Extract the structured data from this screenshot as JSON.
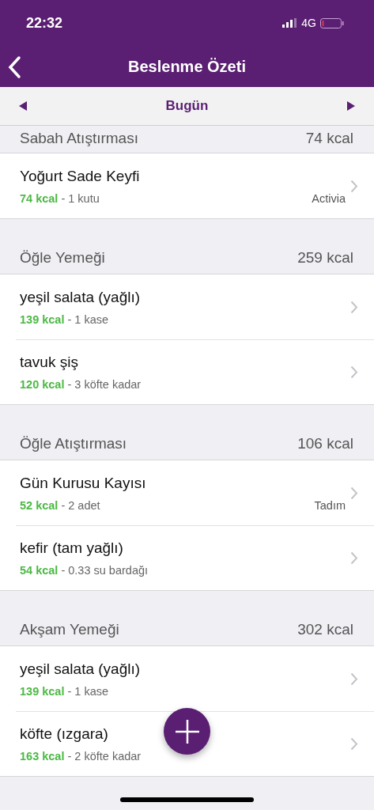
{
  "status_bar": {
    "time": "22:32",
    "network": "4G"
  },
  "nav": {
    "title": "Beslenme Özeti"
  },
  "date_bar": {
    "label": "Bugün"
  },
  "sections": [
    {
      "title": "Sabah Atıştırması",
      "total": "74 kcal",
      "items": [
        {
          "name": "Yoğurt Sade Keyfi",
          "kcal": "74 kcal",
          "portion": "- 1 kutu",
          "brand": "Activia"
        }
      ]
    },
    {
      "title": "Öğle Yemeği",
      "total": "259 kcal",
      "items": [
        {
          "name": "yeşil salata (yağlı)",
          "kcal": "139 kcal",
          "portion": "- 1 kase"
        },
        {
          "name": "tavuk şiş",
          "kcal": "120 kcal",
          "portion": "- 3 köfte kadar"
        }
      ]
    },
    {
      "title": "Öğle Atıştırması",
      "total": "106 kcal",
      "items": [
        {
          "name": "Gün Kurusu Kayısı",
          "kcal": "52 kcal",
          "portion": "- 2 adet",
          "brand": "Tadım"
        },
        {
          "name": "kefir (tam yağlı)",
          "kcal": "54 kcal",
          "portion": "- 0.33 su bardağı"
        }
      ]
    },
    {
      "title": "Akşam Yemeği",
      "total": "302 kcal",
      "items": [
        {
          "name": "yeşil salata (yağlı)",
          "kcal": "139 kcal",
          "portion": "- 1 kase"
        },
        {
          "name": "köfte (ızgara)",
          "kcal": "163 kcal",
          "portion": "- 2 köfte kadar"
        }
      ]
    }
  ]
}
